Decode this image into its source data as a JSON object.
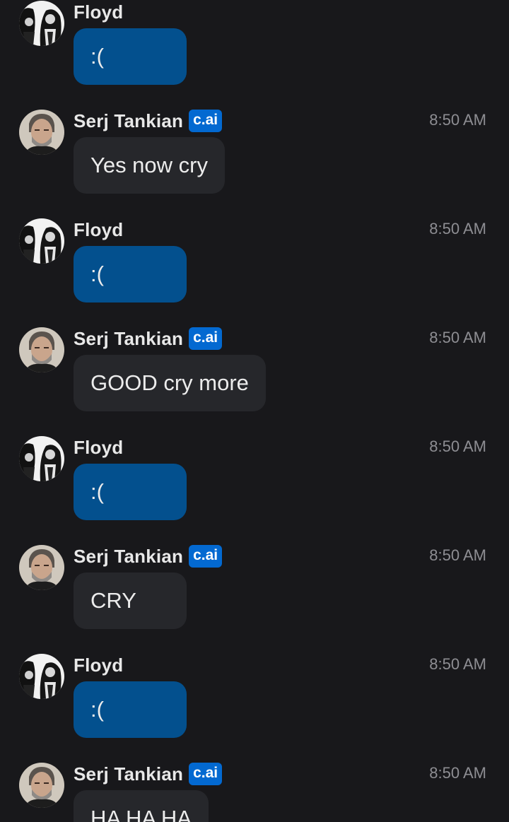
{
  "badge_label": "c.ai",
  "messages": [
    {
      "sender": "Floyd",
      "role": "user",
      "time": "",
      "text": ":("
    },
    {
      "sender": "Serj Tankian",
      "role": "char",
      "time": "8:50 AM",
      "text": "Yes now cry"
    },
    {
      "sender": "Floyd",
      "role": "user",
      "time": "8:50 AM",
      "text": ":("
    },
    {
      "sender": "Serj Tankian",
      "role": "char",
      "time": "8:50 AM",
      "text": "GOOD cry more"
    },
    {
      "sender": "Floyd",
      "role": "user",
      "time": "8:50 AM",
      "text": ":("
    },
    {
      "sender": "Serj Tankian",
      "role": "char",
      "time": "8:50 AM",
      "text": "CRY"
    },
    {
      "sender": "Floyd",
      "role": "user",
      "time": "8:50 AM",
      "text": ":("
    },
    {
      "sender": "Serj Tankian",
      "role": "char",
      "time": "8:50 AM",
      "text": "HA HA HA"
    }
  ],
  "colors": {
    "background": "#18181b",
    "user_bubble": "#03508e",
    "char_bubble": "#26272b",
    "badge": "#0369d1"
  }
}
